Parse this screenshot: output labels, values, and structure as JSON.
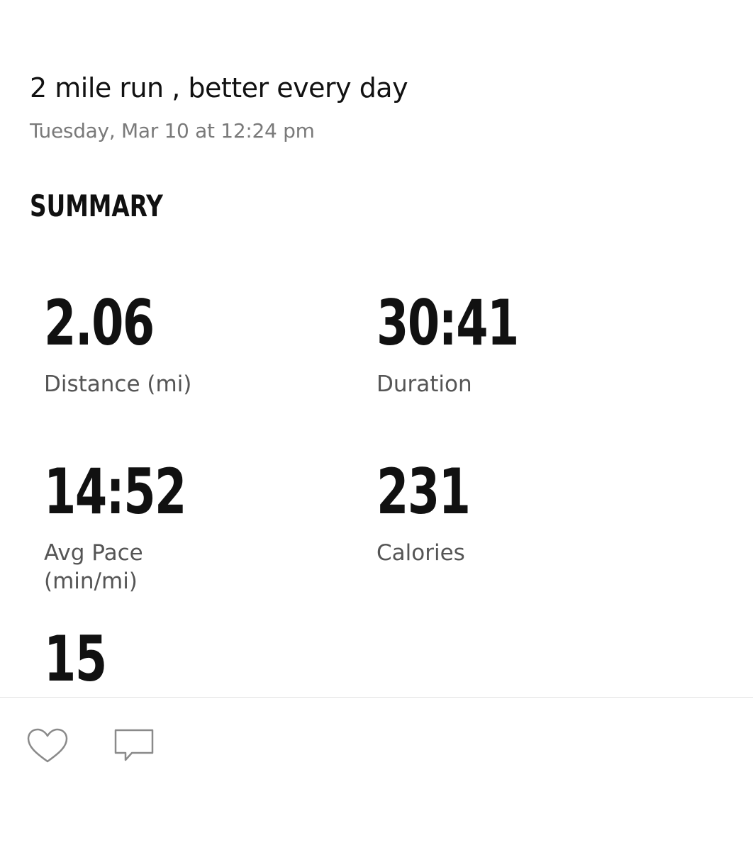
{
  "activity": {
    "title": "2 mile run , better every day",
    "date": "Tuesday, Mar 10 at 12:24 pm"
  },
  "summary": {
    "heading": "SUMMARY",
    "stats": [
      {
        "value": "2.06",
        "label": "Distance (mi)"
      },
      {
        "value": "30:41",
        "label": "Duration"
      },
      {
        "value": "14:52",
        "label": "Avg Pace (min/mi)"
      },
      {
        "value": "231",
        "label": "Calories"
      },
      {
        "value": "15",
        "label": ""
      }
    ]
  },
  "actions": {
    "like_icon": "heart-icon",
    "comment_icon": "comment-icon"
  },
  "colors": {
    "text_primary": "#111111",
    "text_secondary": "#7a7a7a",
    "label": "#555555",
    "icon": "#8a8a8a",
    "divider": "#e2e2e2"
  }
}
